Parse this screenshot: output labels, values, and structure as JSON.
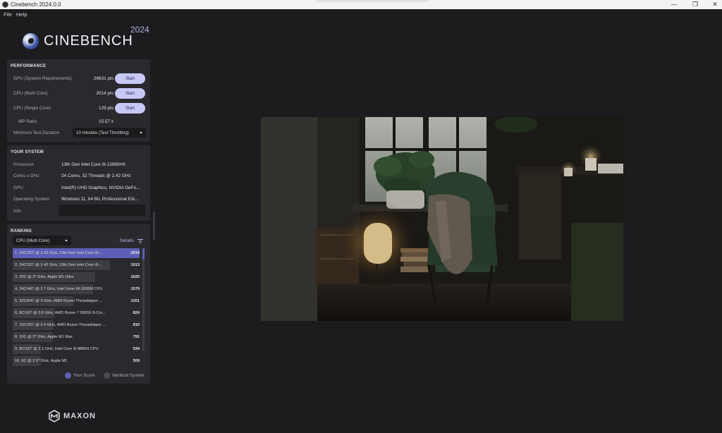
{
  "window": {
    "title": "Cinebench 2024.0.0",
    "minimize_glyph": "—",
    "maximize_glyph": "❐",
    "close_glyph": "✕"
  },
  "menu": {
    "file": "File",
    "help": "Help"
  },
  "brand": {
    "name": "CINEBENCH",
    "year": "2024"
  },
  "performance": {
    "heading": "PERFORMANCE",
    "tests": [
      {
        "label": "GPU (System Requirements)",
        "score": "26631 pts",
        "button": "Start"
      },
      {
        "label": "CPU (Multi Core)",
        "score": "2014 pts",
        "button": "Start"
      },
      {
        "label": "CPU (Single Core)",
        "score": "129 pts",
        "button": "Start"
      }
    ],
    "mp_ratio_label": "MP Ratio",
    "mp_ratio_value": "15.57 x",
    "min_duration_label": "Minimum Test Duration",
    "min_duration_value": "10 minutes (Test Throttling)"
  },
  "system": {
    "heading": "YOUR SYSTEM",
    "rows": [
      {
        "label": "Processor",
        "value": "13th Gen Intel Core i9-13980HX"
      },
      {
        "label": "Cores x GHz",
        "value": "24 Cores, 32 Threads @ 2.42 GHz"
      },
      {
        "label": "GPU",
        "value": "Intel(R) UHD Graphics, NVIDIA GeFo..."
      },
      {
        "label": "Operating System",
        "value": "Windows 11, 64 Bit, Professional Edi..."
      },
      {
        "label": "Info",
        "value": ""
      }
    ]
  },
  "ranking": {
    "heading": "RANKING",
    "filter_value": "CPU (Multi Core)",
    "details_label": "Details",
    "entries": [
      {
        "name": "1. 24C/32T @ 2.42 GHz, 13th Gen Intel Core i9-...",
        "score": "2014",
        "active": true,
        "level": 1.0
      },
      {
        "name": "2. 24C/32T @ 2.42 GHz, 13th Gen Intel Core i9-...",
        "score": "1913",
        "active": false,
        "level": 0.95
      },
      {
        "name": "3. 20C @ 3* GHz, Apple M1 Ultra",
        "score": "1625",
        "active": false,
        "level": 0.807
      },
      {
        "name": "4. 24C/48T @ 2.7 GHz, Intel Xeon W-3265M CPU",
        "score": "1579",
        "active": false,
        "level": 0.784
      },
      {
        "name": "5. 32C/64T @ 3 GHz, AMD Ryzen Threadripper ...",
        "score": "1201",
        "active": false,
        "level": 0.596
      },
      {
        "name": "6. 8C/16T @ 3.8 GHz, AMD Ryzen 7 5800X 8-Cor...",
        "score": "824",
        "active": false,
        "level": 0.409
      },
      {
        "name": "7. 16C/32T @ 3.4 GHz, AMD Ryzen Threadripper ...",
        "score": "810",
        "active": false,
        "level": 0.402
      },
      {
        "name": "8. 10C @ 3* GHz, Apple M1 Max",
        "score": "791",
        "active": false,
        "level": 0.393
      },
      {
        "name": "9. 8C/16T @ 2.3 GHz, Intel Core i9-9880H CPU",
        "score": "534",
        "active": false,
        "level": 0.265
      },
      {
        "name": "10. 8C @ 2.5* GHz, Apple M1",
        "score": "509",
        "active": false,
        "level": 0.253
      }
    ],
    "legend_your_score": "Your Score",
    "legend_identical": "Identical System",
    "colors": {
      "your_score": "#5d5fb4",
      "identical": "#4a4a56"
    }
  },
  "footer": {
    "brand": "MAXON"
  }
}
